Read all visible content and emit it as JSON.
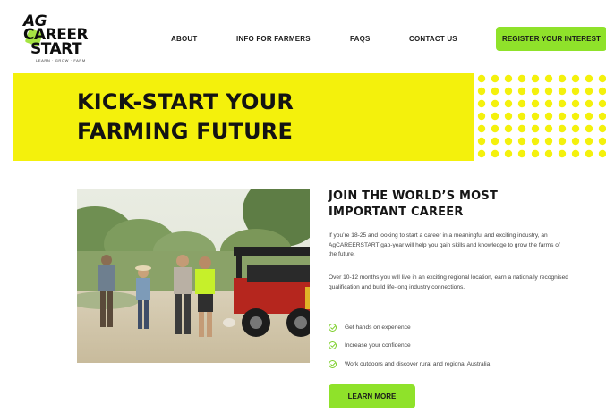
{
  "logo": {
    "line1": "AG",
    "line2": "CAREER",
    "line3": "START",
    "tagline": "LEARN · GROW · FARM"
  },
  "nav": {
    "items": [
      "ABOUT",
      "INFO FOR FARMERS",
      "FAQS",
      "CONTACT US"
    ],
    "register_label": "REGISTER YOUR INTEREST"
  },
  "hero": {
    "title_line1": "KICK-START YOUR",
    "title_line2": "FARMING FUTURE"
  },
  "main": {
    "title_line1": "JOIN THE WORLD’S MOST",
    "title_line2": "IMPORTANT CAREER",
    "paragraph1": "If you’re 18-25 and looking to start a career in a meaningful and exciting industry, an AgCAREERSTART gap-year will help you gain skills and knowledge to grow the farms of the future.",
    "paragraph2": "Over 10-12 months you will live in an exciting regional location, earn a nationally recognised qualification and build life-long industry connections.",
    "checklist": [
      "Get hands on experience",
      "Increase your confidence",
      "Work outdoors and discover rural and regional Australia"
    ],
    "cta_label": "LEARN MORE"
  },
  "colors": {
    "accent_green": "#8fe22a",
    "hero_yellow": "#f4f10c",
    "dots_yellow": "#f4f10c"
  },
  "icons": [
    "check-circle-icon"
  ]
}
